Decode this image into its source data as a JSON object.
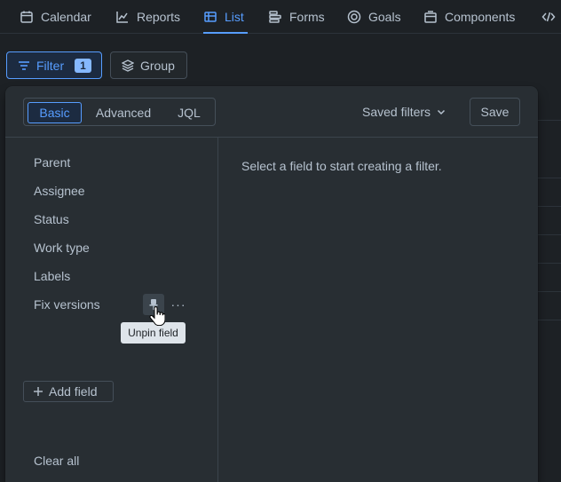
{
  "nav": {
    "tabs": [
      {
        "label": "Calendar",
        "icon": "calendar-icon"
      },
      {
        "label": "Reports",
        "icon": "chart-line-icon"
      },
      {
        "label": "List",
        "icon": "list-table-icon",
        "active": true
      },
      {
        "label": "Forms",
        "icon": "forms-icon"
      },
      {
        "label": "Goals",
        "icon": "goals-icon"
      },
      {
        "label": "Components",
        "icon": "component-icon"
      },
      {
        "label": "",
        "icon": "code-icon"
      }
    ]
  },
  "toolbar": {
    "filter_label": "Filter",
    "filter_count": "1",
    "group_label": "Group"
  },
  "popover": {
    "modes": [
      "Basic",
      "Advanced",
      "JQL"
    ],
    "active_mode": "Basic",
    "saved_filters_label": "Saved filters",
    "save_label": "Save",
    "fields": [
      "Parent",
      "Assignee",
      "Status",
      "Work type",
      "Labels",
      "Fix versions"
    ],
    "more_label": "···",
    "add_field_label": "Add field",
    "tooltip": "Unpin field",
    "clear_all_label": "Clear all",
    "empty_message": "Select a field to start creating a filter."
  },
  "colors": {
    "background": "#1d2125",
    "popover": "#282e33",
    "accent": "#579dff",
    "text": "#b6c2cf"
  }
}
